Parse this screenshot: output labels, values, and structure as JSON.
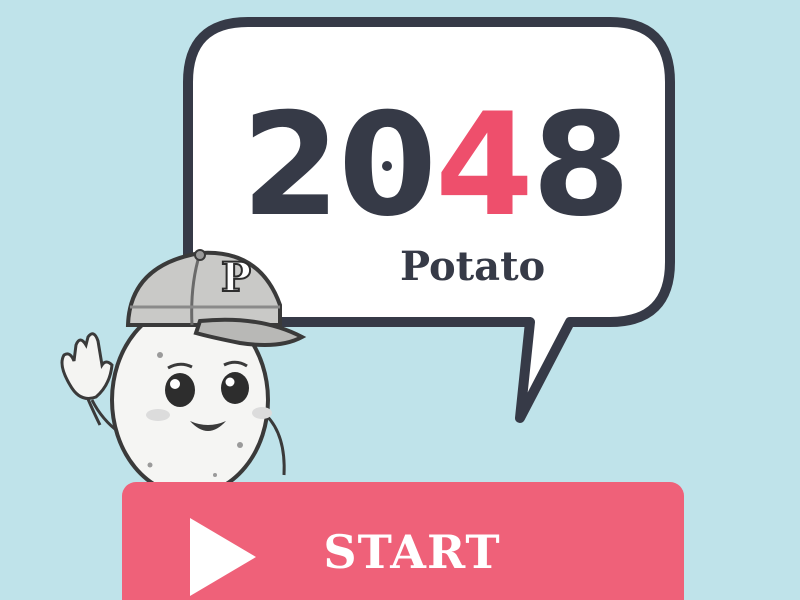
{
  "title": {
    "digit_1": "2",
    "digit_2": "0",
    "digit_3": "4",
    "digit_4": "8",
    "subtitle": "Potato"
  },
  "mascot": {
    "cap_letter": "P"
  },
  "start_button": {
    "label": "START",
    "icon": "play-icon"
  },
  "colors": {
    "background": "#bfe3ea",
    "bubble_fill": "#ffffff",
    "bubble_outline": "#363a47",
    "title_text": "#363a47",
    "accent": "#ee4f6c",
    "button": "#ef6179",
    "button_text": "#ffffff"
  }
}
